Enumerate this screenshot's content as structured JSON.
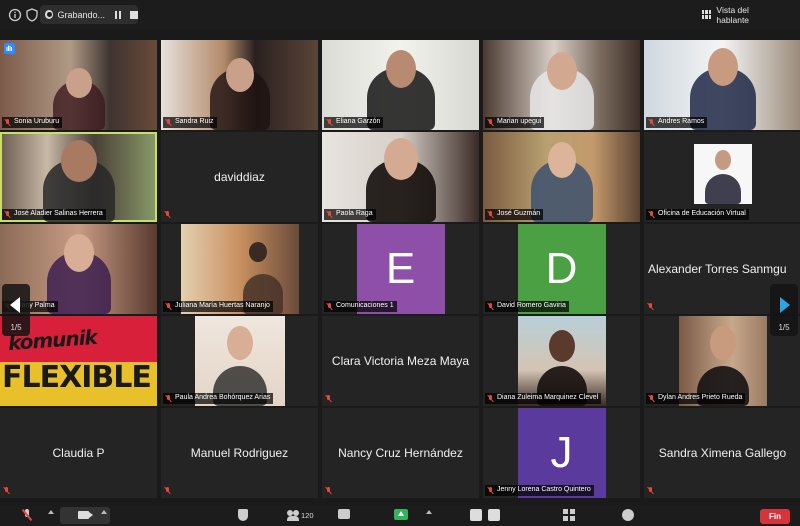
{
  "topbar": {
    "recording_label": "Grabando...",
    "speaker_view_label": "Vista del hablante"
  },
  "gallery": {
    "page_indicator_left": "1/5",
    "page_indicator_right": "1/5",
    "tiles": [
      {
        "id": "sonia",
        "name": "Sonia Uruburu",
        "type": "video"
      },
      {
        "id": "sandra-ruiz",
        "name": "Sandra Ruiz",
        "type": "video"
      },
      {
        "id": "eliana",
        "name": "Eliana Garzón",
        "type": "video"
      },
      {
        "id": "marian",
        "name": "Marian upegui",
        "type": "video"
      },
      {
        "id": "andres",
        "name": "Andres Ramos",
        "type": "video"
      },
      {
        "id": "jose-aladier",
        "name": "José Aladier Salinas Herrera",
        "type": "video"
      },
      {
        "id": "daviddiaz",
        "name": "daviddiaz",
        "type": "name-only"
      },
      {
        "id": "paola",
        "name": "Paola Raga",
        "type": "video"
      },
      {
        "id": "jose-guzman",
        "name": "José Guzmán",
        "type": "video"
      },
      {
        "id": "oficina",
        "name": "Oficina de Educación Virtual",
        "type": "video"
      },
      {
        "id": "tifany",
        "name": "Tifany Palma",
        "type": "video"
      },
      {
        "id": "juliana",
        "name": "Juliana María Huertas Naranjo",
        "type": "video"
      },
      {
        "id": "comunicaciones",
        "name": "Comunicaciones 1",
        "type": "avatar",
        "initial": "E",
        "color": "#8e4fa8"
      },
      {
        "id": "david-romero",
        "name": "David Romero Gaviria",
        "type": "avatar",
        "initial": "D",
        "color": "#4aa043"
      },
      {
        "id": "alexander",
        "name": "Alexander Torres Sanmiguel",
        "display": "Alexander Torres Sanmgu",
        "type": "name-only"
      },
      {
        "id": "komunik",
        "name": "",
        "type": "logo",
        "logo_top": "komunik",
        "logo_bottom": "FLEXIBLE"
      },
      {
        "id": "paula",
        "name": "Paula Andrea Bohórquez Arias",
        "type": "video"
      },
      {
        "id": "clara",
        "name": "Clara Victoria Meza Maya",
        "type": "name-only"
      },
      {
        "id": "diana",
        "name": "Diana Zuleima Marquinez Clevel",
        "type": "video"
      },
      {
        "id": "dylan",
        "name": "Dylan Andres Prieto Rueda",
        "type": "video"
      },
      {
        "id": "claudia",
        "name": "Claudia P",
        "type": "name-only"
      },
      {
        "id": "manuel",
        "name": "Manuel Rodriguez",
        "type": "name-only"
      },
      {
        "id": "nancy",
        "name": "Nancy Cruz Hernández",
        "type": "name-only"
      },
      {
        "id": "jenny",
        "name": "Jenny Lorena Castro Quintero",
        "type": "avatar",
        "initial": "J",
        "color": "#5b3a9e"
      },
      {
        "id": "sandra-gallego",
        "name": "Sandra Ximena Gallego",
        "type": "name-only"
      }
    ]
  },
  "toolbar": {
    "participants_count": "120",
    "end_label": "Fin"
  },
  "colors": {
    "active_speaker": "#c7e06a",
    "end_button": "#d5353a",
    "share_button": "#2fb55a",
    "muted": "#e5483d"
  }
}
